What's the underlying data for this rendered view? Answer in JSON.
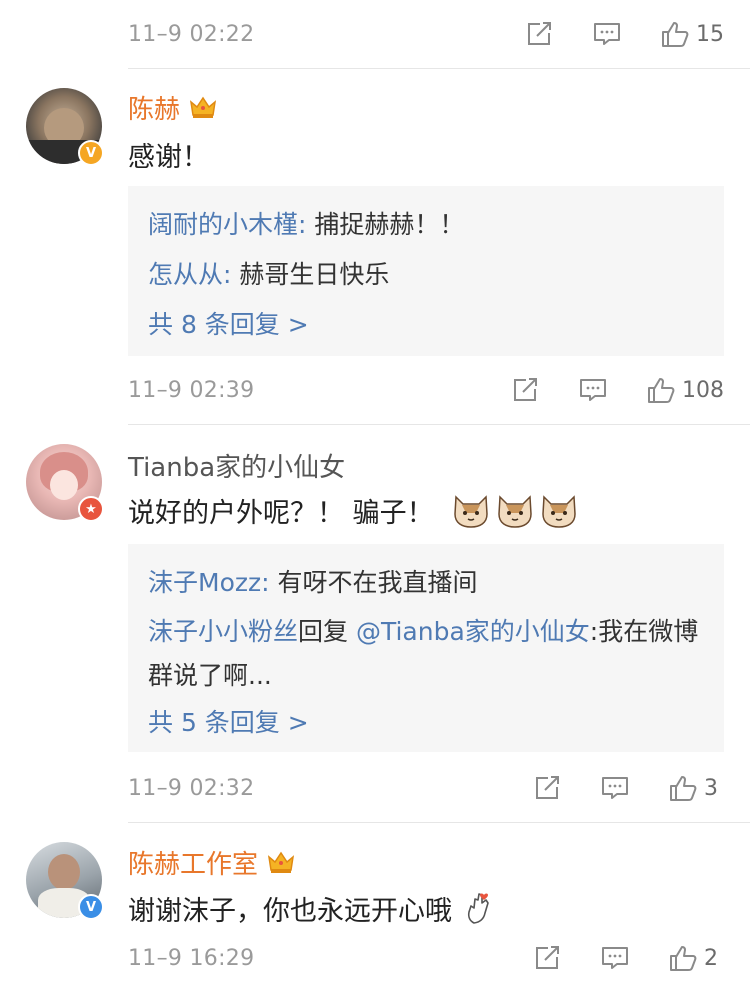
{
  "comments": [
    {
      "time": "11–9 02:22",
      "like_count": "15"
    },
    {
      "name": "陈赫",
      "text": "感谢！",
      "replies": [
        {
          "author": "阔耐的小木槿",
          "sep": ": ",
          "text": "捕捉赫赫！！"
        },
        {
          "author": "怎从从",
          "sep": ": ",
          "text": "赫哥生日快乐"
        }
      ],
      "more": "共 8 条回复 >",
      "time": "11–9 02:39",
      "like_count": "108"
    },
    {
      "name": "Tianba家的小仙女",
      "text": "说好的户外呢？！ 骗子！",
      "replies": [
        {
          "author": "沫子Mozz",
          "sep": ": ",
          "text": "有呀不在我直播间"
        },
        {
          "author": "沫子小小粉丝",
          "mid": "回复 ",
          "mention": "@Tianba家的小仙女",
          "text": ":我在微博群说了啊..."
        }
      ],
      "more": "共 5 条回复 >",
      "time": "11–9 02:32",
      "like_count": "3"
    },
    {
      "name": "陈赫工作室",
      "text": "谢谢沫子，你也永远开心哦",
      "time": "11–9 16:29",
      "like_count": "2"
    }
  ],
  "colors": {
    "vip_name": "#e8772b",
    "link_blue": "#4f7ab3",
    "badge_orange": "#f5a623",
    "badge_blue": "#3a8ee6",
    "badge_red": "#e8553e"
  },
  "icons": [
    "share-icon",
    "comment-icon",
    "like-icon",
    "crown-icon",
    "cat-emoji-icon",
    "hand-heart-emoji-icon",
    "verified-badge-icon"
  ]
}
